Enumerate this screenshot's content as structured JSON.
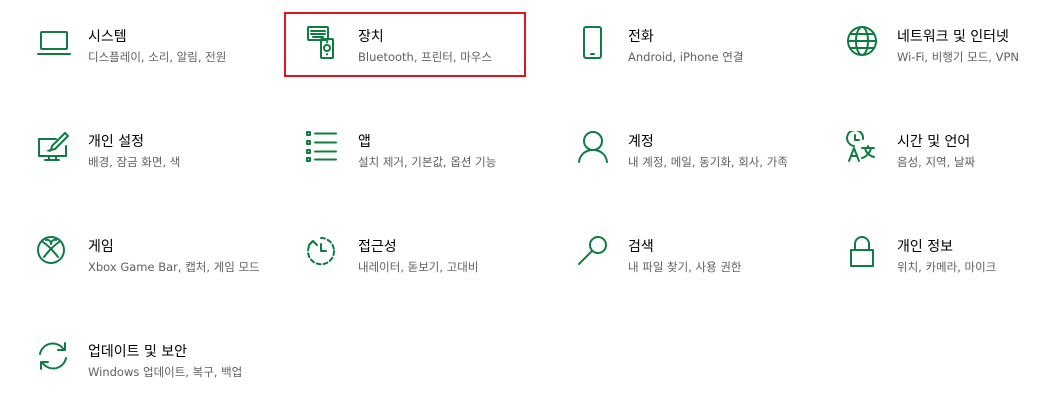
{
  "colors": {
    "accent": "#107c41",
    "highlight": "#e0161e"
  },
  "items": [
    {
      "title": "시스템",
      "desc": "디스플레이, 소리, 알림, 전원",
      "icon": "laptop-icon"
    },
    {
      "title": "장치",
      "desc": "Bluetooth, 프린터, 마우스",
      "icon": "devices-icon"
    },
    {
      "title": "전화",
      "desc": "Android, iPhone 연결",
      "icon": "phone-icon"
    },
    {
      "title": "네트워크 및 인터넷",
      "desc": "Wi-Fi, 비행기 모드, VPN",
      "icon": "globe-icon"
    },
    {
      "title": "개인 설정",
      "desc": "배경, 잠금 화면, 색",
      "icon": "personalization-icon"
    },
    {
      "title": "앱",
      "desc": "설치 제거, 기본값, 옵션 기능",
      "icon": "apps-list-icon"
    },
    {
      "title": "계정",
      "desc": "내 계정, 메일, 동기화, 회사, 가족",
      "icon": "person-icon"
    },
    {
      "title": "시간 및 언어",
      "desc": "음성, 지역, 날짜",
      "icon": "time-language-icon"
    },
    {
      "title": "게임",
      "desc": "Xbox Game Bar, 캡처, 게임 모드",
      "icon": "xbox-icon"
    },
    {
      "title": "접근성",
      "desc": "내레이터, 돋보기, 고대비",
      "icon": "ease-of-access-icon"
    },
    {
      "title": "검색",
      "desc": "내 파일 찾기, 사용 권한",
      "icon": "search-icon"
    },
    {
      "title": "개인 정보",
      "desc": "위치, 카메라, 마이크",
      "icon": "lock-icon"
    },
    {
      "title": "업데이트 및 보안",
      "desc": "Windows 업데이트, 복구, 백업",
      "icon": "sync-icon"
    }
  ]
}
